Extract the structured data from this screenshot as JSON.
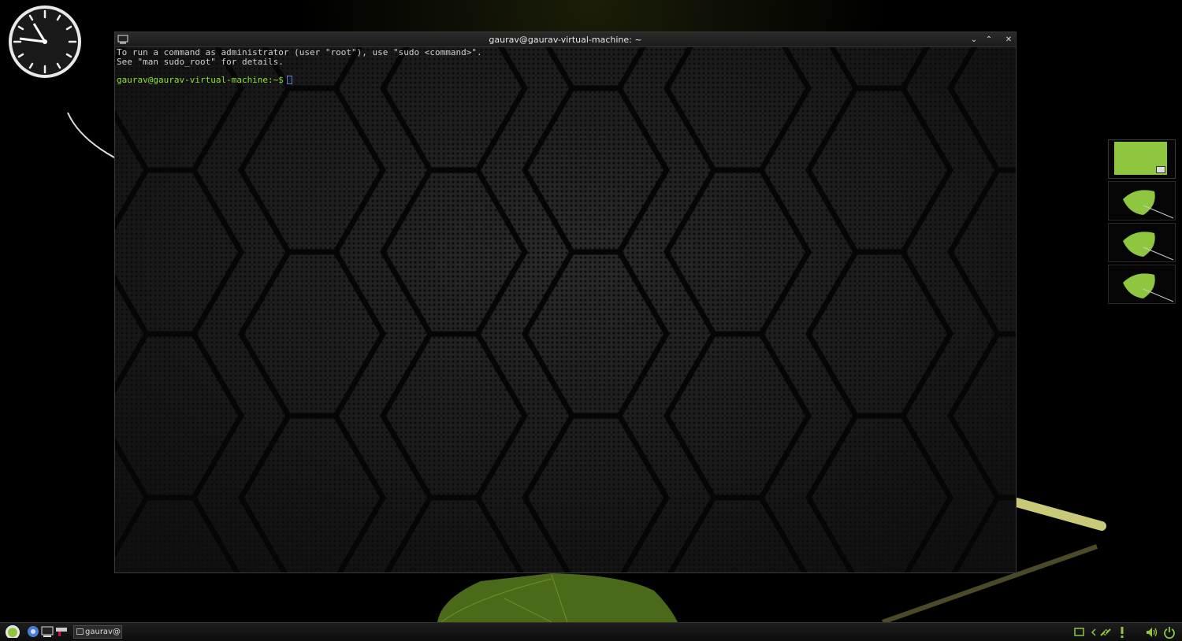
{
  "window": {
    "title": "gaurav@gaurav-virtual-machine: ~",
    "controls": {
      "minimize": "⌄",
      "maximize": "⌃",
      "close": "✕"
    }
  },
  "terminal": {
    "line1": "To run a command as administrator (user \"root\"), use \"sudo <command>\".",
    "line2": "See \"man sudo_root\" for details.",
    "prompt": "gaurav@gaurav-virtual-machine:~$"
  },
  "taskbar": {
    "task_label": "gaurav@..."
  },
  "workspaces": {
    "count": 4,
    "active_index": 0
  },
  "icons": {
    "menu": "mint-menu-icon",
    "browser": "chromium-icon",
    "terminal": "terminal-icon",
    "files": "file-manager-icon",
    "tray": [
      "display-icon",
      "arrow-icon",
      "network-icon",
      "alert-icon",
      "volume-icon",
      "power-icon"
    ]
  },
  "colors": {
    "accent": "#8fc63f",
    "prompt": "#8ae234"
  }
}
